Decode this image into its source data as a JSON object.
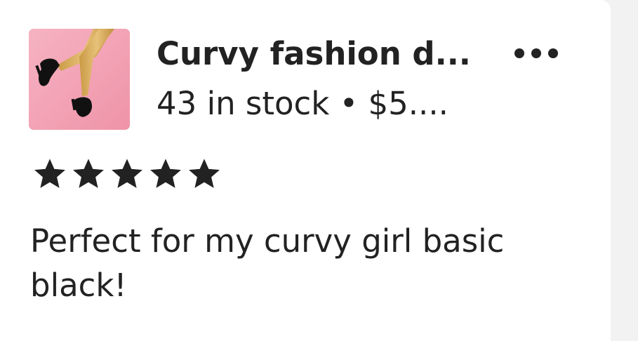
{
  "listing": {
    "title": "Curvy fashion d...",
    "stock_price": "43 in stock • $5....",
    "thumbnail_icon": "doll-legs-black-heels-image"
  },
  "menu": {
    "icon": "more-options-icon"
  },
  "rating": {
    "value": 5,
    "max": 5,
    "star_color": "#222222"
  },
  "review": {
    "text": "Perfect for my curvy girl basic black!"
  },
  "colors": {
    "thumbnail_background": "#f2a3b3",
    "text": "#222222",
    "card": "#ffffff",
    "page_background": "#f2f2f2"
  }
}
